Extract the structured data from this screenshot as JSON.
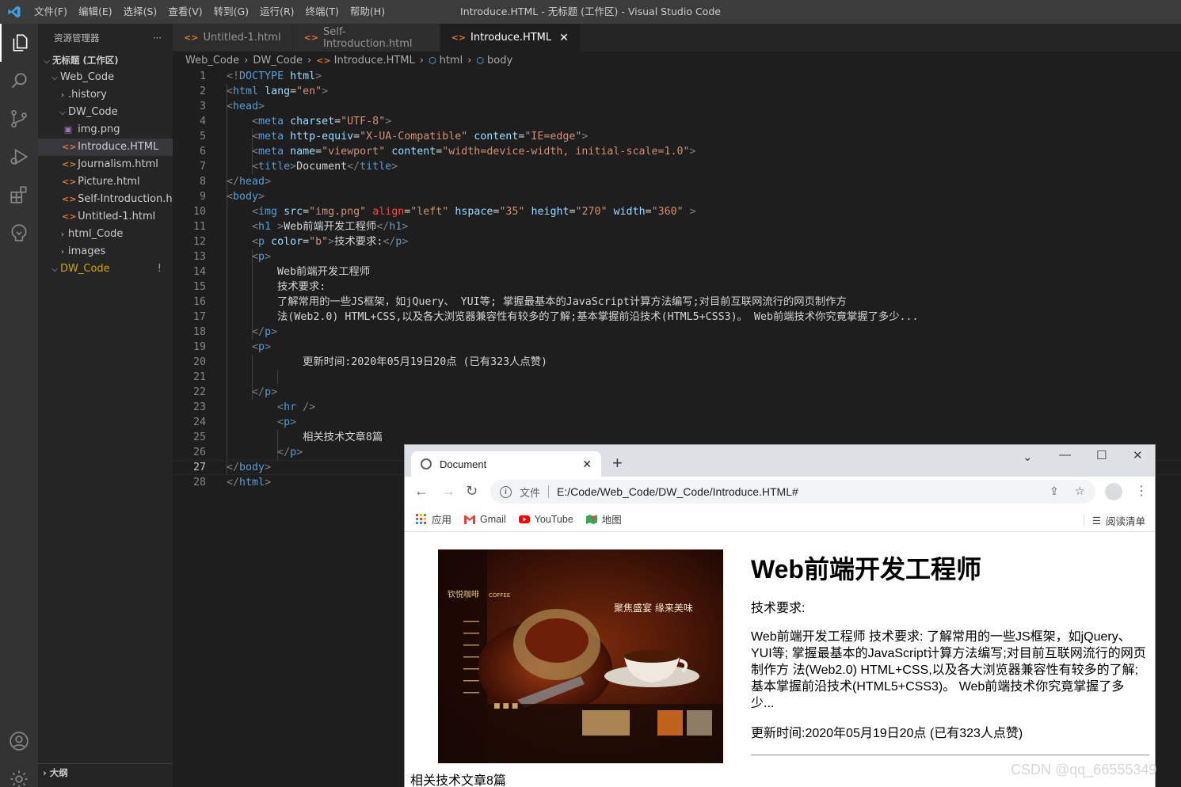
{
  "titlebar": {
    "menu": [
      "文件(F)",
      "编辑(E)",
      "选择(S)",
      "查看(V)",
      "转到(G)",
      "运行(R)",
      "终端(T)",
      "帮助(H)"
    ],
    "window_title": "Introduce.HTML - 无标题 (工作区) - Visual Studio Code"
  },
  "activitybar": {
    "icons": [
      "explorer-icon",
      "search-icon",
      "source-control-icon",
      "run-debug-icon",
      "extensions-icon",
      "remote-icon",
      "account-icon",
      "settings-gear-icon"
    ]
  },
  "sidebar": {
    "title": "资源管理器",
    "more": "···",
    "workspace": "无标题 (工作区)",
    "tree": [
      {
        "label": "Web_Code",
        "level": 1,
        "type": "folder-open"
      },
      {
        "label": ".history",
        "level": 2,
        "type": "folder"
      },
      {
        "label": "DW_Code",
        "level": 2,
        "type": "folder-open"
      },
      {
        "label": "img.png",
        "level": 3,
        "type": "image"
      },
      {
        "label": "Introduce.HTML",
        "level": 3,
        "type": "html",
        "selected": true
      },
      {
        "label": "Journalism.html",
        "level": 3,
        "type": "html"
      },
      {
        "label": "Picture.html",
        "level": 3,
        "type": "html"
      },
      {
        "label": "Self-Introduction.h...",
        "level": 3,
        "type": "html"
      },
      {
        "label": "Untitled-1.html",
        "level": 3,
        "type": "html"
      },
      {
        "label": "html_Code",
        "level": 2,
        "type": "folder"
      },
      {
        "label": "images",
        "level": 2,
        "type": "folder"
      },
      {
        "label": "DW_Code",
        "level": 1,
        "type": "folder-open",
        "warn": true,
        "badge": "!"
      }
    ],
    "outline": "大纲"
  },
  "tabs": [
    {
      "label": "Untitled-1.html",
      "active": false
    },
    {
      "label": "Self-Introduction.html",
      "active": false
    },
    {
      "label": "Introduce.HTML",
      "active": true,
      "close": "✕"
    }
  ],
  "breadcrumb": [
    "Web_Code",
    "DW_Code",
    "Introduce.HTML",
    "html",
    "body"
  ],
  "editor": {
    "current_line": 27,
    "lines": [
      "<!DOCTYPE html>",
      "<html lang=\"en\">",
      "<head>",
      "    <meta charset=\"UTF-8\">",
      "    <meta http-equiv=\"X-UA-Compatible\" content=\"IE=edge\">",
      "    <meta name=\"viewport\" content=\"width=device-width, initial-scale=1.0\">",
      "    <title>Document</title>",
      "</head>",
      "<body>",
      "    <img src=\"img.png\" align=\"left\" hspace=\"35\" height=\"270\" width=\"360\" >",
      "    <h1 >Web前端开发工程师</h1>",
      "    <p color=\"b\">技术要求:</p>",
      "    <p>",
      "        Web前端开发工程师",
      "        技术要求:",
      "        了解常用的一些JS框架，如jQuery、 YUI等; 掌握最基本的JavaScript计算方法编写;对目前互联网流行的网页制作方",
      "        法(Web2.0) HTML+CSS,以及各大浏览器兼容性有较多的了解;基本掌握前沿技术(HTML5+CSS3)。 Web前端技术你究竟掌握了多少...",
      "    </p>",
      "    <p>",
      "            更新时间:2020年05月19日20点 (已有323人点赞)",
      "",
      "    </p>",
      "        <hr />",
      "        <p>",
      "            相关技术文章8篇",
      "        </p>",
      "</body>",
      "</html>"
    ]
  },
  "browser": {
    "tab_title": "Document",
    "tab_close": "✕",
    "new_tab": "+",
    "address_scheme": "文件",
    "address_url": "E:/Code/Web_Code/DW_Code/Introduce.HTML#",
    "bookmarks": [
      {
        "label": "应用",
        "icon": "apps-grid-icon"
      },
      {
        "label": "Gmail",
        "icon": "gmail-icon"
      },
      {
        "label": "YouTube",
        "icon": "youtube-icon"
      },
      {
        "label": "地图",
        "icon": "maps-icon"
      }
    ],
    "reading_list": "阅读清单",
    "page": {
      "h1": "Web前端开发工程师",
      "p1": "技术要求:",
      "p2": "Web前端开发工程师 技术要求: 了解常用的一些JS框架，如jQuery、YUI等; 掌握最基本的JavaScript计算方法编写;对目前互联网流行的网页制作方 法(Web2.0) HTML+CSS,以及各大浏览器兼容性有较多的了解;基本掌握前沿技术(HTML5+CSS3)。 Web前端技术你究竟掌握了多少...",
      "p3": "更新时间:2020年05月19日20点 (已有323人点赞)",
      "related": "相关技术文章8篇",
      "image_text": [
        "聚焦盛宴 缘来美味",
        "钦悦咖啡",
        "COFFEE"
      ]
    }
  },
  "watermark": "CSDN @qq_66555349"
}
